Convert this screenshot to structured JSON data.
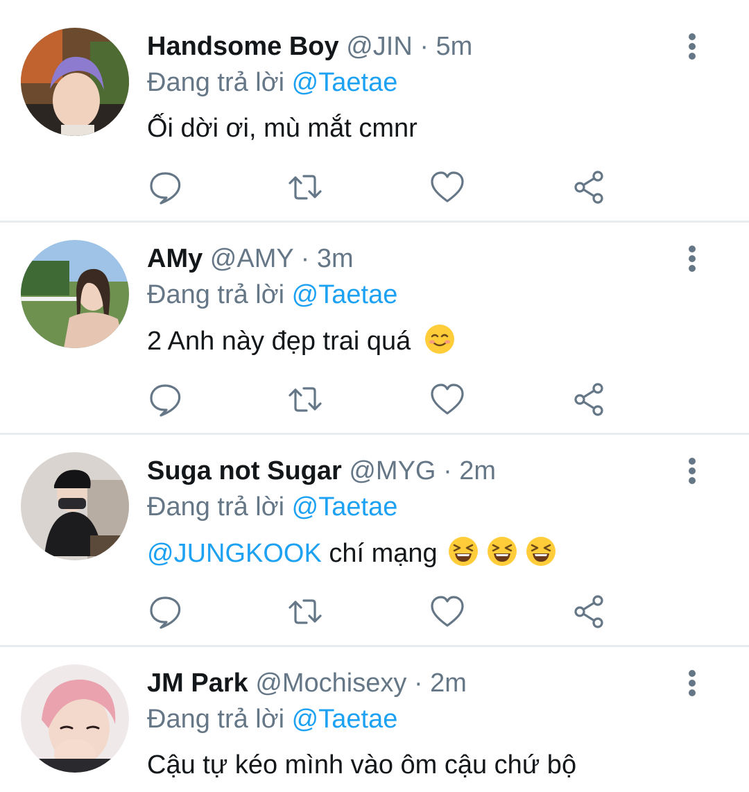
{
  "reply_prefix": "Đang trả lời",
  "tweets": [
    {
      "name": "Handsome Boy",
      "handle": "@JIN",
      "time": "5m",
      "reply_to": "@Taetae",
      "text": "Ối dời ơi, mù mắt cmnr",
      "avatar_icon": "avatar-photo-purple-hair"
    },
    {
      "name": "AMy",
      "handle": "@AMY",
      "time": "3m",
      "reply_to": "@Taetae",
      "text": "2 Anh này đẹp trai quá",
      "emojis": [
        "smiling-face-emoji"
      ],
      "avatar_icon": "avatar-photo-girl-outdoors"
    },
    {
      "name": "Suga not Sugar",
      "handle": "@MYG",
      "time": "2m",
      "reply_to": "@Taetae",
      "text_mention": "@JUNGKOOK",
      "text": "chí mạng",
      "emojis": [
        "laughing-face-emoji",
        "laughing-face-emoji",
        "laughing-face-emoji"
      ],
      "avatar_icon": "avatar-photo-black-cap"
    },
    {
      "name": "JM Park",
      "handle": "@Mochisexy",
      "time": "2m",
      "reply_to": "@Taetae",
      "text": "Cậu tự kéo mình vào ôm cậu chứ bộ",
      "avatar_icon": "avatar-photo-pink-hair"
    }
  ],
  "actions": [
    "reply-icon",
    "retweet-icon",
    "like-icon",
    "share-icon"
  ],
  "colors": {
    "text": "#14171a",
    "muted": "#657786",
    "mention": "#1da1f2",
    "divider": "#e9ecef"
  }
}
